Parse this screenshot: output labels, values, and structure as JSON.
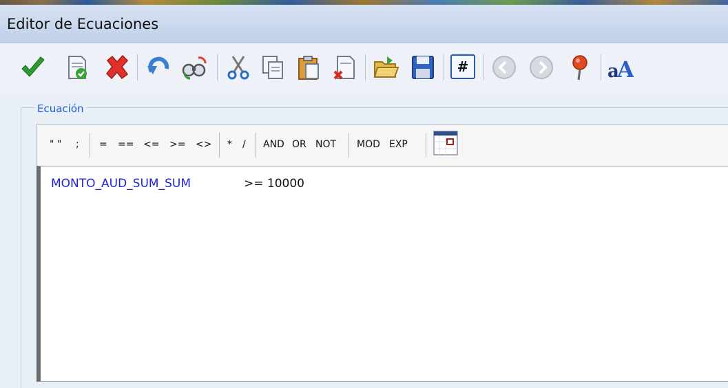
{
  "window": {
    "title": "Editor de Ecuaciones"
  },
  "toolbar": {
    "buttons": [
      {
        "icon": "check-icon",
        "tooltip": ""
      },
      {
        "icon": "validate-document-icon",
        "tooltip": ""
      },
      {
        "icon": "delete-x-icon",
        "tooltip": ""
      },
      {
        "icon": "undo-icon",
        "tooltip": ""
      },
      {
        "icon": "find-replace-icon",
        "tooltip": ""
      },
      {
        "icon": "scissors-icon",
        "tooltip": ""
      },
      {
        "icon": "copy-icon",
        "tooltip": ""
      },
      {
        "icon": "paste-icon",
        "tooltip": ""
      },
      {
        "icon": "delete-document-icon",
        "tooltip": ""
      },
      {
        "icon": "open-folder-icon",
        "tooltip": ""
      },
      {
        "icon": "save-icon",
        "tooltip": ""
      },
      {
        "icon": "hash-icon",
        "tooltip": ""
      },
      {
        "icon": "back-icon",
        "tooltip": ""
      },
      {
        "icon": "forward-icon",
        "tooltip": ""
      },
      {
        "icon": "pin-icon",
        "tooltip": ""
      },
      {
        "icon": "font-icon",
        "tooltip": ""
      }
    ],
    "hash_label": "#"
  },
  "equation": {
    "legend": "Ecuación",
    "operators": {
      "quotes": "\" \"",
      "semicolon": ";",
      "eq": "=",
      "eqeq": "==",
      "le": "<=",
      "ge": ">=",
      "ne": "<>",
      "mul": "*",
      "div": "/",
      "and": "AND",
      "or": "OR",
      "not": "NOT",
      "mod": "MOD",
      "exp": "EXP"
    },
    "expression": {
      "field": "MONTO_AUD_SUM_SUM",
      "operator_value": ">= 10000"
    }
  },
  "colors": {
    "field_text": "#2222dd",
    "legend_text": "#1b5bd6",
    "titlebar": "#c8d8ee"
  }
}
